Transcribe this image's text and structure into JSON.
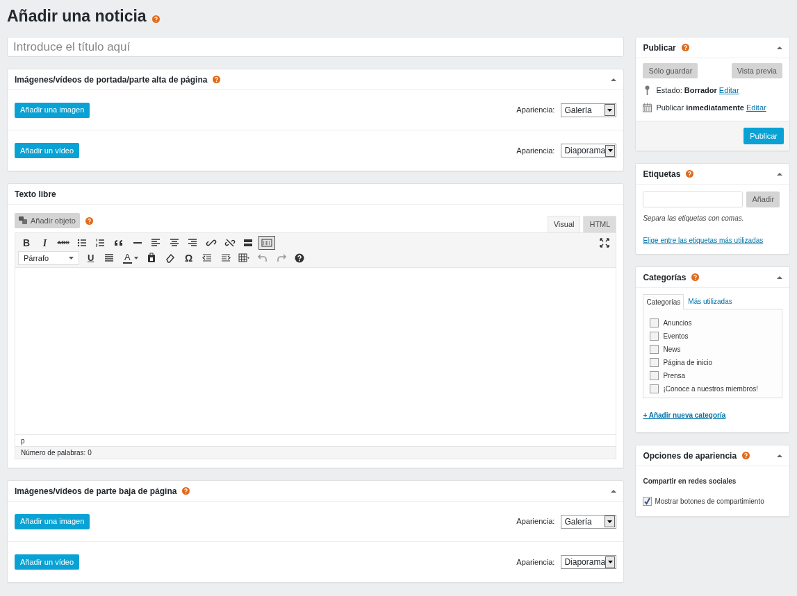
{
  "page_title": "Añadir una noticia",
  "title_field": {
    "placeholder": "Introduce el título aquí"
  },
  "top_media": {
    "title": "Imágenes/vídeos de portada/parte alta de página",
    "expanded": true,
    "rows": [
      {
        "button": "Añadir una imagen",
        "label": "Apariencia:",
        "value": "Galería"
      },
      {
        "button": "Añadir un vídeo",
        "label": "Apariencia:",
        "value": "Diaporama"
      }
    ]
  },
  "editor": {
    "title": "Texto libre",
    "add_object": {
      "label": "Añadir objeto",
      "disabled": true
    },
    "tabs": [
      {
        "label": "Visual",
        "selected": true
      },
      {
        "label": "HTML",
        "selected": false
      }
    ],
    "glyphs": {
      "bold": "B",
      "italic": "I",
      "strike": "ABC",
      "underline": "U",
      "text_color": "A",
      "special_char": "Ω"
    },
    "format": "Párrafo",
    "kitchen_sink_on": true,
    "path": "p",
    "word_count": "Número de palabras: 0"
  },
  "bottom_media": {
    "title": "Imágenes/vídeos de parte baja de página",
    "expanded": true,
    "rows": [
      {
        "button": "Añadir una imagen",
        "label": "Apariencia:",
        "value": "Galería"
      },
      {
        "button": "Añadir un vídeo",
        "label": "Apariencia:",
        "value": "Diaporama"
      }
    ]
  },
  "publish": {
    "title": "Publicar",
    "expanded": true,
    "save": {
      "label": "Sólo guardar",
      "disabled": true
    },
    "preview": {
      "label": "Vista previa",
      "disabled": true
    },
    "status": "Estado: **Borrador**",
    "status_edit": "Editar",
    "schedule": "Publicar **inmediatamente**",
    "schedule_edit": "Editar",
    "publish_button": "Publicar"
  },
  "tags": {
    "title": "Etiquetas",
    "expanded": true,
    "add": {
      "label": "Añadir",
      "disabled": true
    },
    "hint": "Separa las etiquetas con comas.",
    "link": "Elige entre las etiquetas más utilizadas"
  },
  "categories": {
    "title": "Categorías",
    "expanded": true,
    "tabs": [
      {
        "label": "Categorías",
        "selected": true
      },
      {
        "label": "Más utilizadas",
        "selected": false
      }
    ],
    "items": [
      {
        "label": "Anuncios",
        "checked": false
      },
      {
        "label": "Eventos",
        "checked": false
      },
      {
        "label": "News",
        "checked": false
      },
      {
        "label": "Página de inicio",
        "checked": false
      },
      {
        "label": "Prensa",
        "checked": false
      },
      {
        "label": "¡Conoce a nuestros miembros!",
        "checked": false
      }
    ],
    "add_link": "+ Añadir nueva categoría"
  },
  "appearance": {
    "title": "Opciones de apariencia",
    "expanded": true,
    "subtitle": "Compartir en redes sociales",
    "option": {
      "label": "Mostrar botones de compartimiento",
      "checked": true
    }
  }
}
